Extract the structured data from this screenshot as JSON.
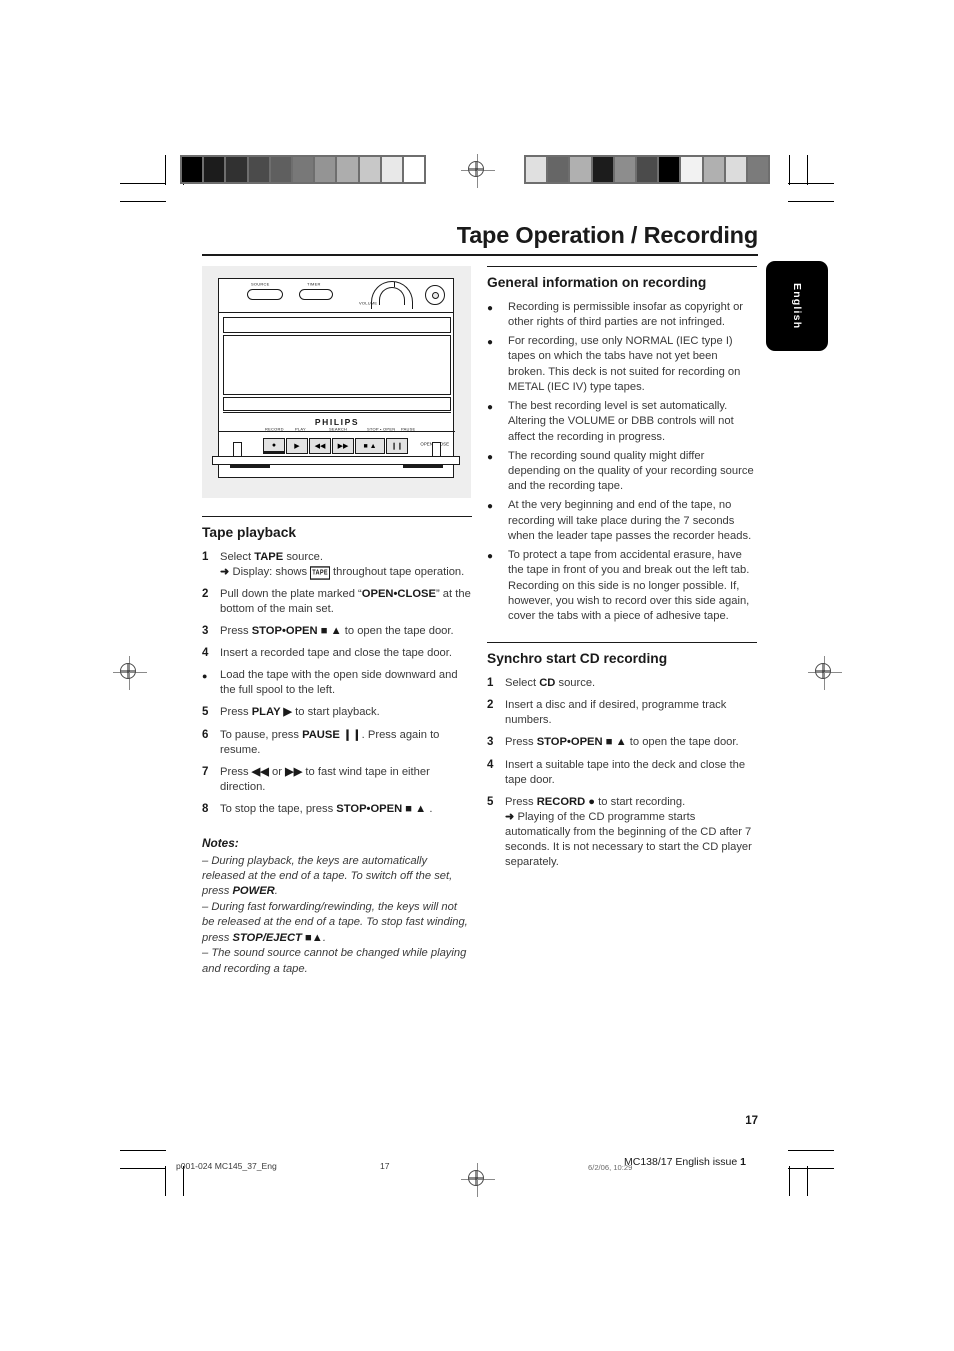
{
  "document": {
    "title": "Tape Operation / Recording",
    "language_tab": "English",
    "page_number": "17"
  },
  "grayscale_bars": {
    "left": [
      "#000000",
      "#1c1c1c",
      "#313131",
      "#4b4b4b",
      "#5f5f5f",
      "#787878",
      "#949494",
      "#adadad",
      "#c8c8c8",
      "#e8e8e8",
      "#ffffff"
    ],
    "right": [
      "#e0e0e0",
      "#666666",
      "#b0b0b0",
      "#1c1c1c",
      "#8d8d8d",
      "#4b4b4b",
      "#000000",
      "#f2f2f2",
      "#b0b0b0",
      "#dcdcdc",
      "#7b7b7b"
    ]
  },
  "figure": {
    "top_labels": [
      "SOURCE",
      "TIMER",
      "VOLUME"
    ],
    "brand": "PHILIPS",
    "control_labels": [
      "RECORD",
      "PLAY",
      "SEARCH",
      "STOP • OPEN",
      "PAUSE"
    ],
    "keys": [
      "●",
      "▶",
      "◀◀",
      "▶▶",
      "■ ▲",
      "❙❙"
    ],
    "open_close_label": "OPEN/CLOSE"
  },
  "left_column": {
    "heading": "Tape playback",
    "steps": [
      {
        "num": "1",
        "parts": [
          {
            "t": "Select "
          },
          {
            "t": "TAPE",
            "b": true
          },
          {
            "t": " source."
          }
        ],
        "results": [
          {
            "parts": [
              {
                "t": "Display: shows "
              },
              {
                "t": "TAPE",
                "chip": true
              },
              {
                "t": " throughout tape operation."
              }
            ]
          }
        ]
      },
      {
        "num": "2",
        "parts": [
          {
            "t": "Pull down the plate marked “"
          },
          {
            "t": "OPEN•CLOSE",
            "b": true
          },
          {
            "t": "” at the bottom of the main set."
          }
        ]
      },
      {
        "num": "3",
        "parts": [
          {
            "t": "Press "
          },
          {
            "t": "STOP•OPEN",
            "b": true
          },
          {
            "t": " ■ ▲ ",
            "glyph": true
          },
          {
            "t": " to open the tape door."
          }
        ]
      },
      {
        "num": "4",
        "parts": [
          {
            "t": "Insert a recorded tape and close the tape door."
          }
        ]
      },
      {
        "num": "●",
        "dot": true,
        "parts": [
          {
            "t": "Load the tape with the open side downward and the full spool to the left."
          }
        ]
      },
      {
        "num": "5",
        "parts": [
          {
            "t": "Press "
          },
          {
            "t": "PLAY",
            "b": true
          },
          {
            "t": " ▶",
            "glyph": true
          },
          {
            "t": " to start playback."
          }
        ]
      },
      {
        "num": "6",
        "parts": [
          {
            "t": "To pause, press "
          },
          {
            "t": "PAUSE",
            "b": true
          },
          {
            "t": " ❙❙",
            "glyph": true
          },
          {
            "t": ". Press again to resume."
          }
        ]
      },
      {
        "num": "7",
        "parts": [
          {
            "t": "Press "
          },
          {
            "t": "◀◀",
            "glyph": true
          },
          {
            "t": " or "
          },
          {
            "t": "▶▶",
            "glyph": true
          },
          {
            "t": " to fast wind tape in either direction."
          }
        ]
      },
      {
        "num": "8",
        "parts": [
          {
            "t": "To stop the tape, press "
          },
          {
            "t": "STOP•OPEN",
            "b": true
          },
          {
            "t": " ■ ▲",
            "glyph": true
          },
          {
            "t": " ."
          }
        ]
      }
    ],
    "notes_title": "Notes:",
    "notes": [
      {
        "parts": [
          {
            "t": "–  During playback, the keys are automatically released at the end of a tape. To switch off the set, press "
          },
          {
            "t": "POWER",
            "b": true
          },
          {
            "t": "."
          }
        ]
      },
      {
        "parts": [
          {
            "t": "–  During fast forwarding/rewinding, the keys will not be released at the end of a tape. To stop fast winding, press "
          },
          {
            "t": "STOP/EJECT",
            "b": true
          },
          {
            "t": " ■▲",
            "glyph": true
          },
          {
            "t": "."
          }
        ]
      },
      {
        "parts": [
          {
            "t": "–  The sound source cannot be changed while playing and recording a tape."
          }
        ]
      }
    ]
  },
  "right_column": {
    "heading_general": "General information on recording",
    "bullets": [
      "Recording is permissible insofar as copyright or other rights of third parties are not infringed.",
      "For recording, use only NORMAL (IEC type I) tapes on which the tabs have not yet been broken. This deck is not suited for recording on METAL (IEC IV) type tapes.",
      "The best recording level is set automatically. Altering the VOLUME or DBB controls will not affect the recording in progress.",
      "The recording sound quality might differ depending on the quality of your recording source and the recording tape.",
      "At the very beginning and end of the tape, no recording will take place during the 7 seconds when the leader tape passes the recorder heads.",
      "To protect a tape from accidental erasure, have the tape in front of you and break out the left tab. Recording on this side is no longer possible. If, however, you wish to record over this side again, cover the tabs with a piece of adhesive tape."
    ],
    "heading_synchro": "Synchro start CD recording",
    "steps": [
      {
        "num": "1",
        "parts": [
          {
            "t": "Select "
          },
          {
            "t": "CD",
            "b": true
          },
          {
            "t": " source."
          }
        ]
      },
      {
        "num": "2",
        "parts": [
          {
            "t": "Insert a disc and if desired, programme track numbers."
          }
        ]
      },
      {
        "num": "3",
        "parts": [
          {
            "t": "Press "
          },
          {
            "t": "STOP•OPEN",
            "b": true
          },
          {
            "t": " ■ ▲",
            "glyph": true
          },
          {
            "t": " to open the tape door."
          }
        ]
      },
      {
        "num": "4",
        "parts": [
          {
            "t": "Insert a suitable tape into the deck and close the tape door."
          }
        ]
      },
      {
        "num": "5",
        "parts": [
          {
            "t": "Press "
          },
          {
            "t": "RECORD",
            "b": true
          },
          {
            "t": " ●",
            "glyph": true
          },
          {
            "t": " to start recording."
          }
        ],
        "results": [
          {
            "parts": [
              {
                "t": "Playing of the CD programme starts automatically from the beginning of the CD after 7 seconds. It is not necessary to start the CD player separately."
              }
            ]
          }
        ]
      }
    ]
  },
  "footer": {
    "left": "p001-024 MC145_37_Eng",
    "page": "17",
    "date": "6/2/06, 10:29",
    "right_prefix": "MC138/17 English issue ",
    "right_issue": "1"
  }
}
